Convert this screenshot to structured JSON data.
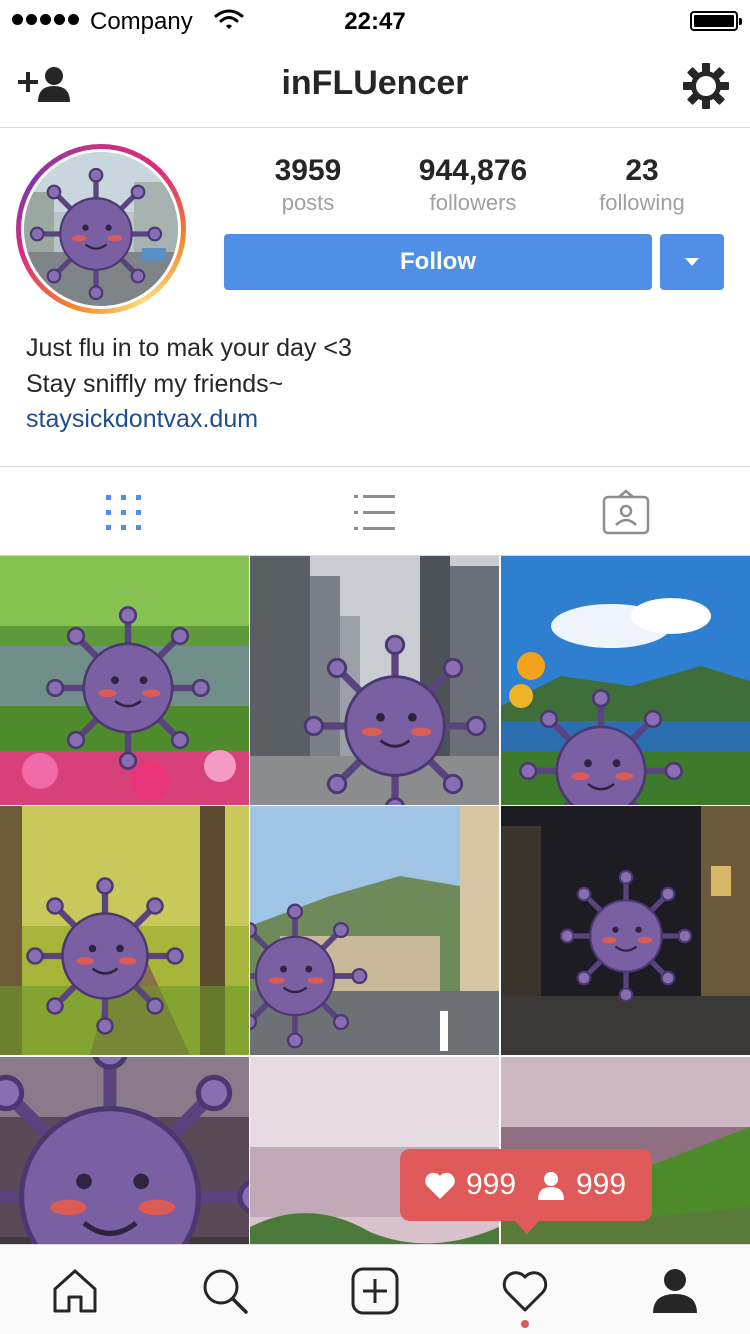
{
  "status_bar": {
    "carrier": "Company",
    "time": "22:47"
  },
  "nav": {
    "title": "inFLUencer",
    "left_icon": "add-user-icon",
    "right_icon": "settings-icon"
  },
  "profile": {
    "stats": [
      {
        "value": "3959",
        "label": "posts"
      },
      {
        "value": "944,876",
        "label": "followers"
      },
      {
        "value": "23",
        "label": "following"
      }
    ],
    "follow_label": "Follow",
    "bio_lines": [
      "Just flu in to mak your day <3",
      "Stay sniffly my friends~"
    ],
    "link": "staysickdontvax.dum"
  },
  "tabs": [
    {
      "icon": "grid-icon",
      "active": true
    },
    {
      "icon": "list-icon",
      "active": false
    },
    {
      "icon": "tagged-icon",
      "active": false
    }
  ],
  "grid": {
    "tiles": [
      {
        "scene": "park pond with flowers"
      },
      {
        "scene": "city street with skyscrapers"
      },
      {
        "scene": "lake with mountains and lilies"
      },
      {
        "scene": "forest path"
      },
      {
        "scene": "hillside town street"
      },
      {
        "scene": "night alley"
      },
      {
        "scene": "sunset shore close-up"
      },
      {
        "scene": "misty lake with grass"
      },
      {
        "scene": "lake with purple flowers"
      }
    ]
  },
  "activity_tooltip": {
    "likes": "999",
    "followers": "999"
  },
  "bottom_bar": {
    "items": [
      "home-icon",
      "search-icon",
      "add-post-icon",
      "activity-icon",
      "profile-icon"
    ]
  },
  "colors": {
    "accent": "#4f8fe6",
    "tooltip": "#e05a5a",
    "link": "#1f4f8a",
    "virus": "#7b5fa3"
  }
}
